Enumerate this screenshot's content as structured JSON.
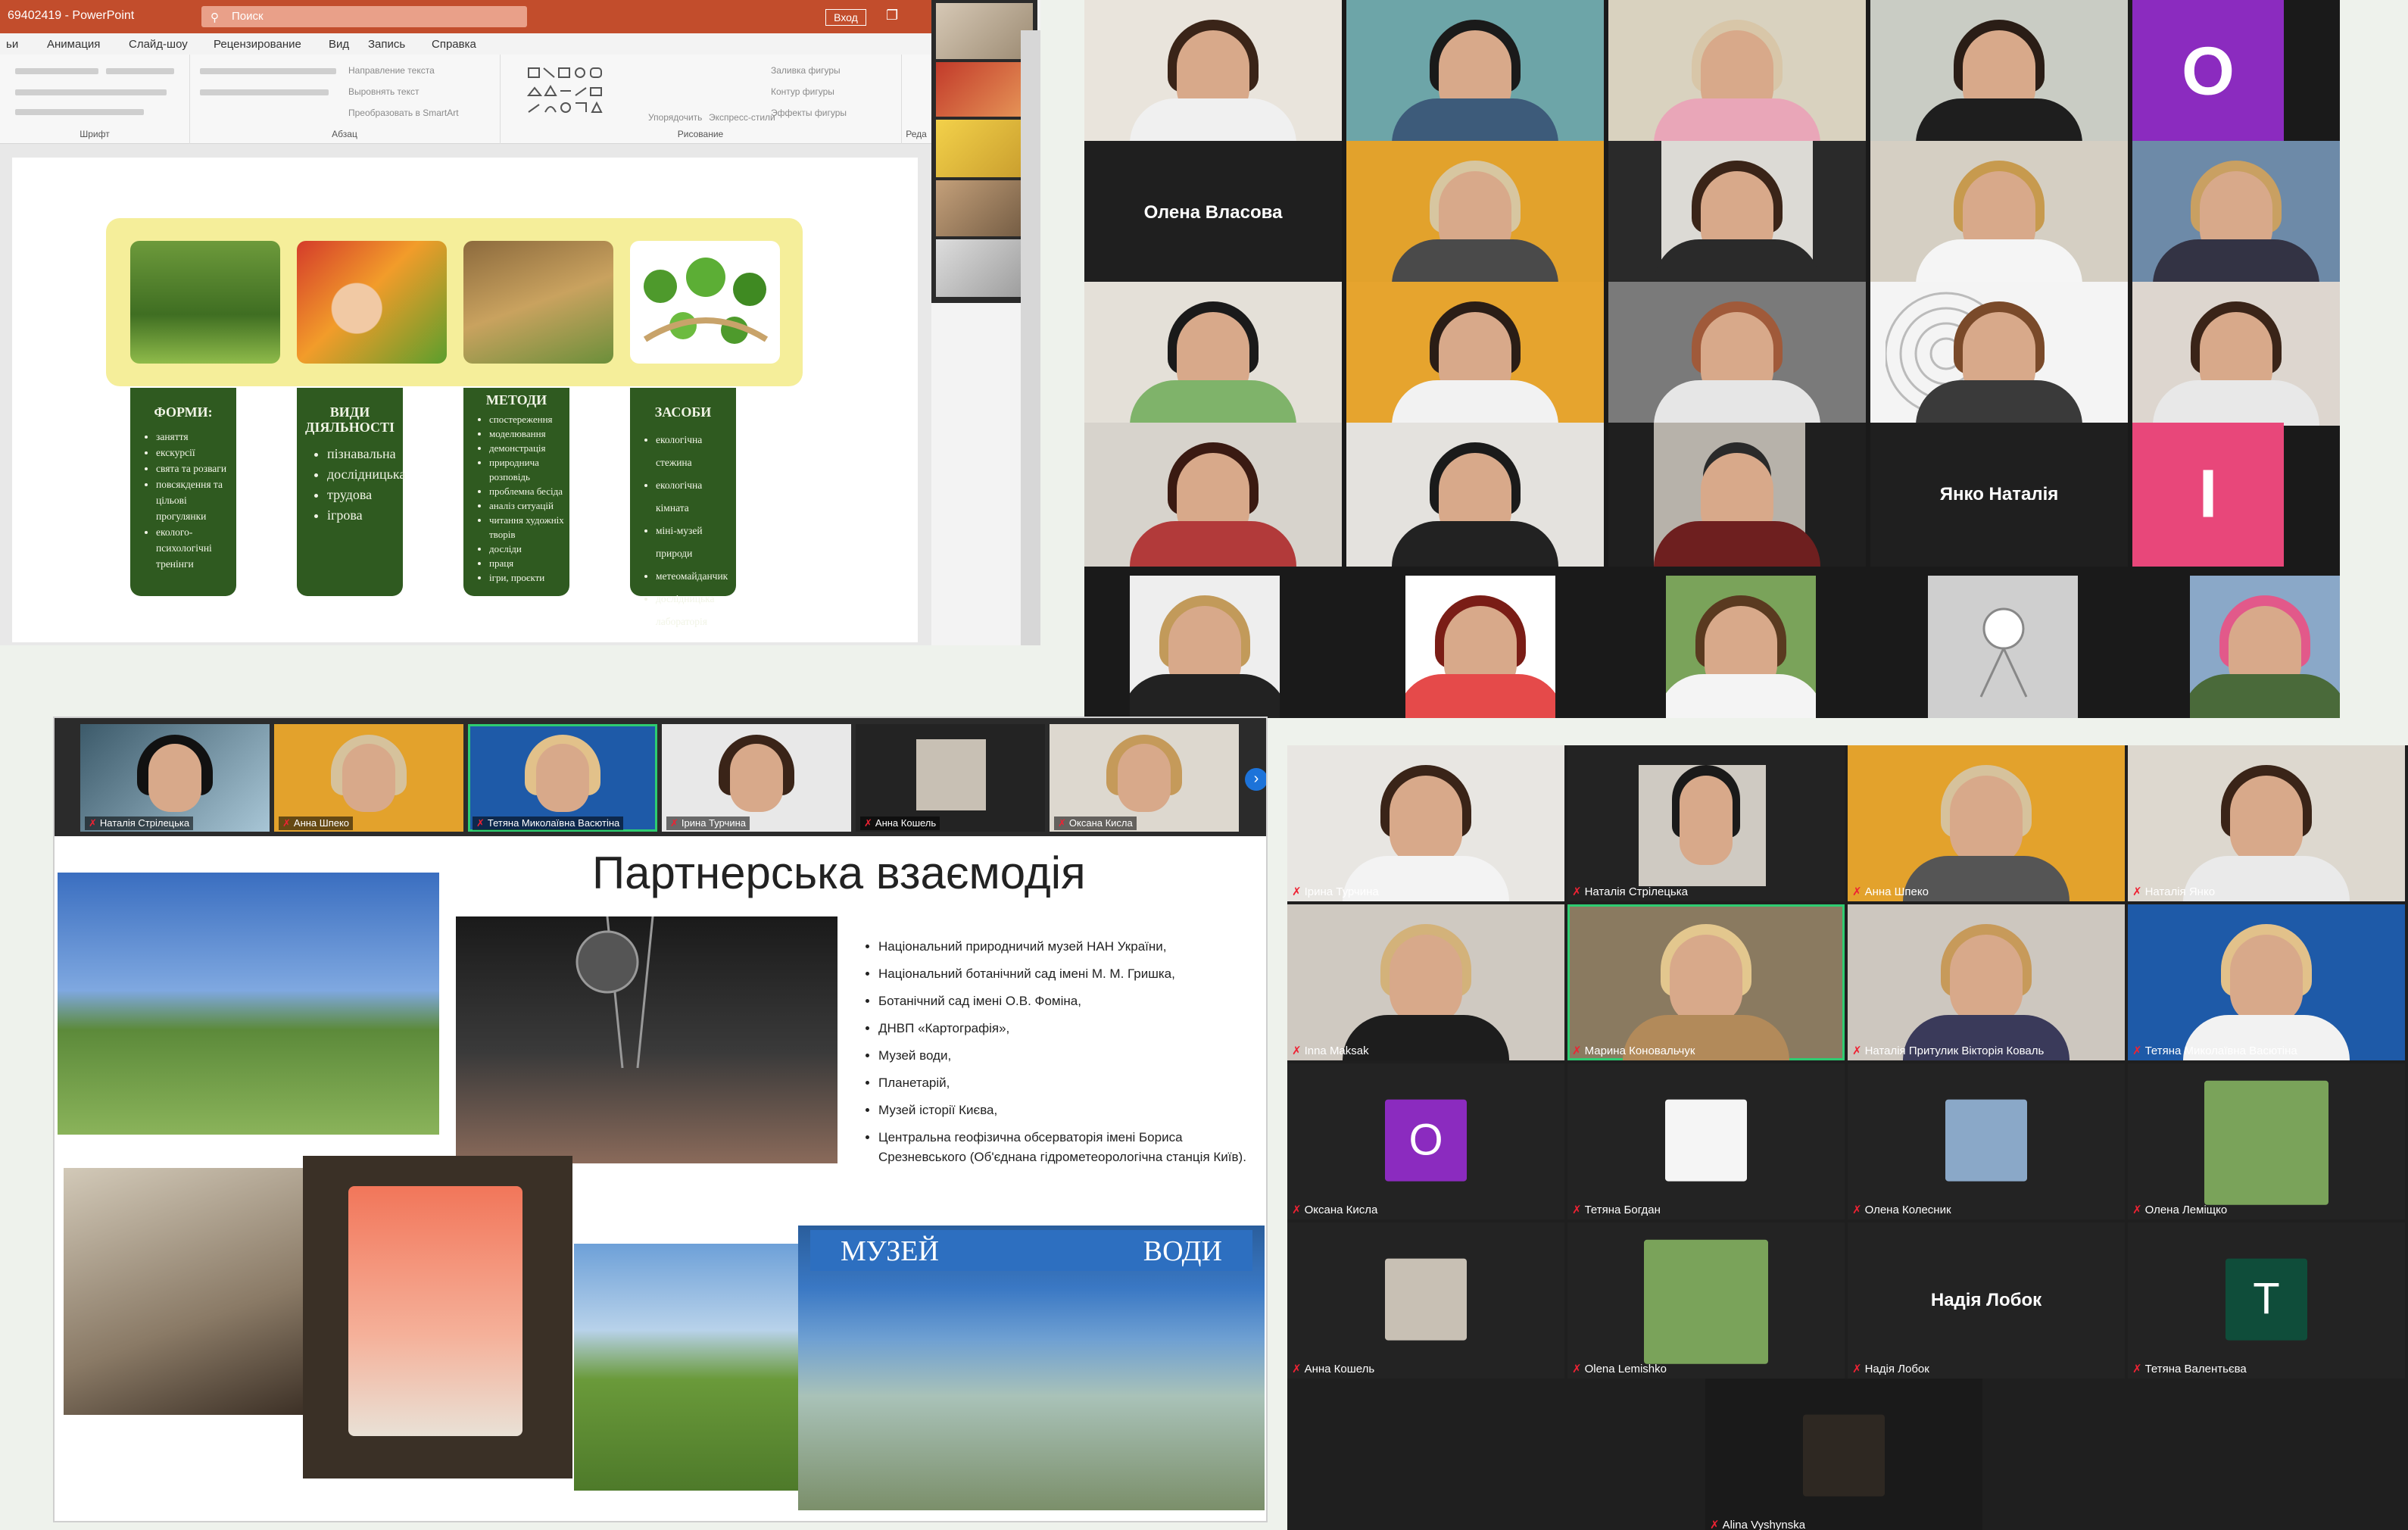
{
  "ppt": {
    "title": "69402419 - PowerPoint",
    "search_placeholder": "Поиск",
    "signin": "Вход",
    "menu": [
      "ьи",
      "Анимация",
      "Слайд-шоу",
      "Рецензирование",
      "Вид",
      "Запись",
      "Справка"
    ],
    "ribbon_groups": [
      "Шрифт",
      "Абзац",
      "Рисование",
      "Реда"
    ],
    "ribbon_items": [
      "Направление текста",
      "Выровнять текст",
      "Преобразовать в SmartArt",
      "Упорядочить",
      "Экспресс-стили",
      "Заливка фигуры",
      "Контур фигуры",
      "Эффекты фигуры"
    ],
    "slide": {
      "columns": [
        {
          "heading": "ФОРМИ:",
          "items": [
            "заняття",
            "екскурсії",
            "свята та розваги",
            "повсякдення та цільові прогулянки",
            "еколого-психологічні тренінги"
          ]
        },
        {
          "heading": "ВИДИ ДІЯЛЬНОСТІ",
          "items": [
            "пізнавальна",
            "дослідницька",
            "трудова",
            "ігрова"
          ]
        },
        {
          "heading": "МЕТОДИ",
          "items": [
            "спостереження",
            "моделювання",
            "демонстрація",
            "природнича розповідь",
            "проблемна бесіда",
            "аналіз ситуацій",
            "читання художніх творів",
            "досліди",
            "праця",
            "ігри, проєкти"
          ]
        },
        {
          "heading": "ЗАСОБИ",
          "items": [
            "екологічна стежина",
            "екологічна кімната",
            "міні-музей природи",
            "метеомайданчик",
            "дослідницька лабораторія"
          ]
        }
      ]
    }
  },
  "gallery1": {
    "name_tiles": [
      "Олена Власова",
      "Янко Наталія"
    ],
    "letters": [
      "О",
      "І"
    ]
  },
  "slide2": {
    "participants": [
      "Наталія Стрілецька",
      "Анна Шпеко",
      "Тетяна Миколаївна Васютіна",
      "Ірина Турчина",
      "Анна Кошель",
      "Оксана Кисла"
    ],
    "title": "Партнерська взаємодія",
    "partners": [
      "Національний природничий музей НАН України,",
      "Національний ботанічний сад імені М. М. Гришка,",
      "Ботанічний сад імені О.В. Фоміна,",
      "ДНВП «Картографія»,",
      "Музей води,",
      "Планетарій,",
      "Музей історії Києва,",
      "Центральна геофізична обсерваторія імені Бориса Срезневського (Об'єднана гідрометеорологічна станція Київ)."
    ],
    "museum_sign_left": "МУЗЕЙ",
    "museum_sign_right": "ВОДИ"
  },
  "gallery2": {
    "tiles": [
      {
        "name": "Ірина Турчина"
      },
      {
        "name": "Наталія Стрілецька"
      },
      {
        "name": "Анна Шпеко"
      },
      {
        "name": "Наталія Янко"
      },
      {
        "name": "Inna Maksak"
      },
      {
        "name": "Марина Коновальчук"
      },
      {
        "name": "Наталія Притулик Вікторія Коваль"
      },
      {
        "name": "Тетяна Миколаївна Васютіна"
      },
      {
        "name": "Оксана Кисла",
        "letter": "О"
      },
      {
        "name": "Тетяна Богдан"
      },
      {
        "name": "Олена Колесник"
      },
      {
        "name": "Олена Леміщко"
      },
      {
        "name": "Анна Кошель"
      },
      {
        "name": "Olena  Lemishko"
      },
      {
        "name": "Надія Лобок",
        "center": "Надія Лобок"
      },
      {
        "name": "Тетяна Валентьєва",
        "letter": "Т"
      },
      {
        "name": "Alina Vyshynska"
      }
    ],
    "colors": {
      "purple": "#8b2bbf",
      "green": "#0f4d3a",
      "active": "#2ecc71"
    }
  }
}
